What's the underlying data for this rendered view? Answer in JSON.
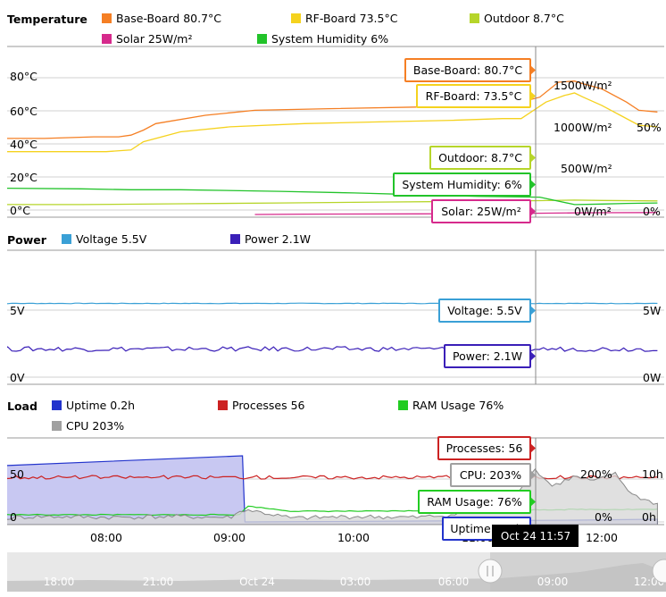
{
  "sections": {
    "temperature": "Temperature",
    "power": "Power",
    "load": "Load"
  },
  "colors": {
    "base_board": "#f57f24",
    "rf_board": "#f5d21e",
    "outdoor": "#b6d52a",
    "solar": "#d62a8c",
    "system_humidity": "#22c32a",
    "voltage": "#3aa0d6",
    "power": "#3a1fb8",
    "uptime": "#2233cc",
    "processes": "#cc2222",
    "ram_usage": "#22cc22",
    "cpu": "#a0a0a0",
    "grid": "#d0d0d0",
    "crosshair": "#888888",
    "navigator_bg": "#e6e6e6"
  },
  "tooltip_time": "Oct 24 11:57",
  "chart_data": [
    {
      "type": "line",
      "title": "Temperature",
      "legend_placement": "top",
      "y_ticks_left": [
        "80°C",
        "60°C",
        "40°C",
        "20°C",
        "0°C"
      ],
      "y_ticks_right": [
        "1500W/m²",
        "1000W/m²",
        "500W/m²",
        "0W/m²"
      ],
      "y_ticks_right_pct": [
        "50%",
        "0%"
      ],
      "ylim": [
        0,
        100
      ],
      "series": [
        {
          "name": "Base-Board",
          "legend": "Base-Board  80.7°C",
          "tooltip": "Base-Board: 80.7°C",
          "color_key": "base_board",
          "values": [
            [
              7.0,
              46
            ],
            [
              7.5,
              46
            ],
            [
              7.9,
              47
            ],
            [
              8.1,
              47
            ],
            [
              8.2,
              48
            ],
            [
              8.3,
              51
            ],
            [
              8.4,
              55
            ],
            [
              8.8,
              60
            ],
            [
              9.2,
              63
            ],
            [
              9.8,
              64
            ],
            [
              10.5,
              65
            ],
            [
              11.0,
              65
            ],
            [
              11.3,
              67
            ],
            [
              11.5,
              71
            ],
            [
              11.65,
              80
            ],
            [
              11.78,
              80.7
            ],
            [
              11.85,
              79
            ],
            [
              12.0,
              76
            ],
            [
              12.2,
              68
            ],
            [
              12.3,
              63
            ],
            [
              12.45,
              62
            ]
          ]
        },
        {
          "name": "RF-Board",
          "legend": "RF-Board  73.5°C",
          "tooltip": "RF-Board: 73.5°C",
          "color_key": "rf_board",
          "values": [
            [
              7.0,
              38
            ],
            [
              7.5,
              38
            ],
            [
              8.0,
              38
            ],
            [
              8.2,
              39
            ],
            [
              8.3,
              44
            ],
            [
              8.6,
              50
            ],
            [
              9.0,
              53
            ],
            [
              9.6,
              55
            ],
            [
              10.2,
              56
            ],
            [
              10.8,
              57
            ],
            [
              11.2,
              58
            ],
            [
              11.35,
              58
            ],
            [
              11.45,
              63
            ],
            [
              11.55,
              68
            ],
            [
              11.7,
              72
            ],
            [
              11.78,
              73.5
            ],
            [
              11.85,
              71
            ],
            [
              12.0,
              66
            ],
            [
              12.15,
              60
            ],
            [
              12.3,
              54
            ],
            [
              12.45,
              53
            ]
          ]
        },
        {
          "name": "Outdoor",
          "legend": "Outdoor  8.7°C",
          "tooltip": "Outdoor: 8.7°C",
          "color_key": "outdoor",
          "values": [
            [
              7.0,
              6
            ],
            [
              7.8,
              6
            ],
            [
              8.6,
              6.5
            ],
            [
              9.4,
              7
            ],
            [
              10.2,
              7.5
            ],
            [
              11.0,
              8
            ],
            [
              11.5,
              8.4
            ],
            [
              11.78,
              8.7
            ],
            [
              12.0,
              8.5
            ],
            [
              12.45,
              8.2
            ]
          ]
        },
        {
          "name": "Solar",
          "legend": "Solar  25W/m²",
          "tooltip": "Solar: 25W/m²",
          "color_key": "solar",
          "values": [
            [
              9.2,
              0
            ],
            [
              9.6,
              0.2
            ],
            [
              10.5,
              0.4
            ],
            [
              11.3,
              0.6
            ],
            [
              11.78,
              1.0
            ],
            [
              12.0,
              1.1
            ],
            [
              12.45,
              1.2
            ]
          ]
        },
        {
          "name": "System Humidity",
          "legend": "System Humidity  6%",
          "tooltip": "System Humidity: 6%",
          "color_key": "system_humidity",
          "values": [
            [
              7.0,
              16
            ],
            [
              7.8,
              15.5
            ],
            [
              8.2,
              15
            ],
            [
              8.6,
              15
            ],
            [
              9.4,
              14
            ],
            [
              10.0,
              13
            ],
            [
              10.5,
              12
            ],
            [
              11.0,
              11
            ],
            [
              11.5,
              10.5
            ],
            [
              11.78,
              6
            ],
            [
              11.8,
              6
            ],
            [
              12.0,
              6.3
            ],
            [
              12.2,
              6.7
            ],
            [
              12.45,
              7
            ]
          ]
        }
      ]
    },
    {
      "type": "line",
      "title": "Power",
      "legend_placement": "top",
      "y_ticks_left": [
        "5V",
        "0V"
      ],
      "y_ticks_right": [
        "5W",
        "0W"
      ],
      "ylim": [
        0,
        6.5
      ],
      "series": [
        {
          "name": "Voltage",
          "legend": "Voltage  5.5V",
          "tooltip": "Voltage: 5.5V",
          "color_key": "voltage",
          "values": [
            [
              7.0,
              5.5
            ],
            [
              12.45,
              5.5
            ]
          ]
        },
        {
          "name": "Power",
          "legend": "Power  2.1W",
          "tooltip": "Power: 2.1W",
          "color_key": "power",
          "values": [
            [
              7.0,
              2.1
            ],
            [
              12.45,
              2.1
            ]
          ]
        }
      ]
    },
    {
      "type": "line",
      "title": "Load",
      "legend_placement": "top",
      "y_ticks_left": [
        "50",
        "0"
      ],
      "y_ticks_right": [
        "10h",
        "0h"
      ],
      "y_ticks_right_pct": [
        "200%",
        "0%"
      ],
      "x_ticks": [
        "08:00",
        "09:00",
        "10:00",
        "11:00",
        "12:00"
      ],
      "ylim": [
        0,
        100
      ],
      "series": [
        {
          "name": "Uptime",
          "legend": "Uptime  0.2h",
          "tooltip": "Uptime: 0.2h",
          "color_key": "uptime",
          "values": [
            [
              7.0,
              62
            ],
            [
              9.1,
              74
            ],
            [
              9.12,
              0
            ],
            [
              11.78,
              2
            ],
            [
              12.45,
              3
            ]
          ]
        },
        {
          "name": "Processes",
          "legend": "Processes  56",
          "tooltip": "Processes: 56",
          "color_key": "processes",
          "values": [
            [
              7.0,
              50
            ],
            [
              12.45,
              50
            ]
          ]
        },
        {
          "name": "RAM Usage",
          "legend": "RAM Usage  76%",
          "tooltip": "RAM Usage: 76%",
          "color_key": "ram_usage",
          "values": [
            [
              7.0,
              8
            ],
            [
              9.1,
              8
            ],
            [
              9.12,
              18
            ],
            [
              9.5,
              12
            ],
            [
              10.2,
              12
            ],
            [
              11.78,
              14
            ],
            [
              12.45,
              14
            ]
          ]
        },
        {
          "name": "CPU",
          "legend": "CPU  203%",
          "tooltip": "CPU: 203%",
          "color_key": "cpu",
          "values": [
            [
              7.0,
              4
            ],
            [
              7.5,
              6
            ],
            [
              8.0,
              5
            ],
            [
              8.5,
              6
            ],
            [
              9.0,
              5
            ],
            [
              9.12,
              14
            ],
            [
              9.5,
              4
            ],
            [
              10.0,
              6
            ],
            [
              10.5,
              5
            ],
            [
              10.8,
              8
            ],
            [
              11.0,
              12
            ],
            [
              11.3,
              30
            ],
            [
              11.45,
              60
            ],
            [
              11.6,
              40
            ],
            [
              11.78,
              50.75
            ],
            [
              11.95,
              45
            ],
            [
              12.1,
              55
            ],
            [
              12.25,
              30
            ],
            [
              12.45,
              20
            ]
          ]
        }
      ]
    }
  ],
  "navigator": {
    "labels": [
      "18:00",
      "21:00",
      "Oct 24",
      "03:00",
      "06:00",
      "09:00",
      "12:00"
    ]
  }
}
